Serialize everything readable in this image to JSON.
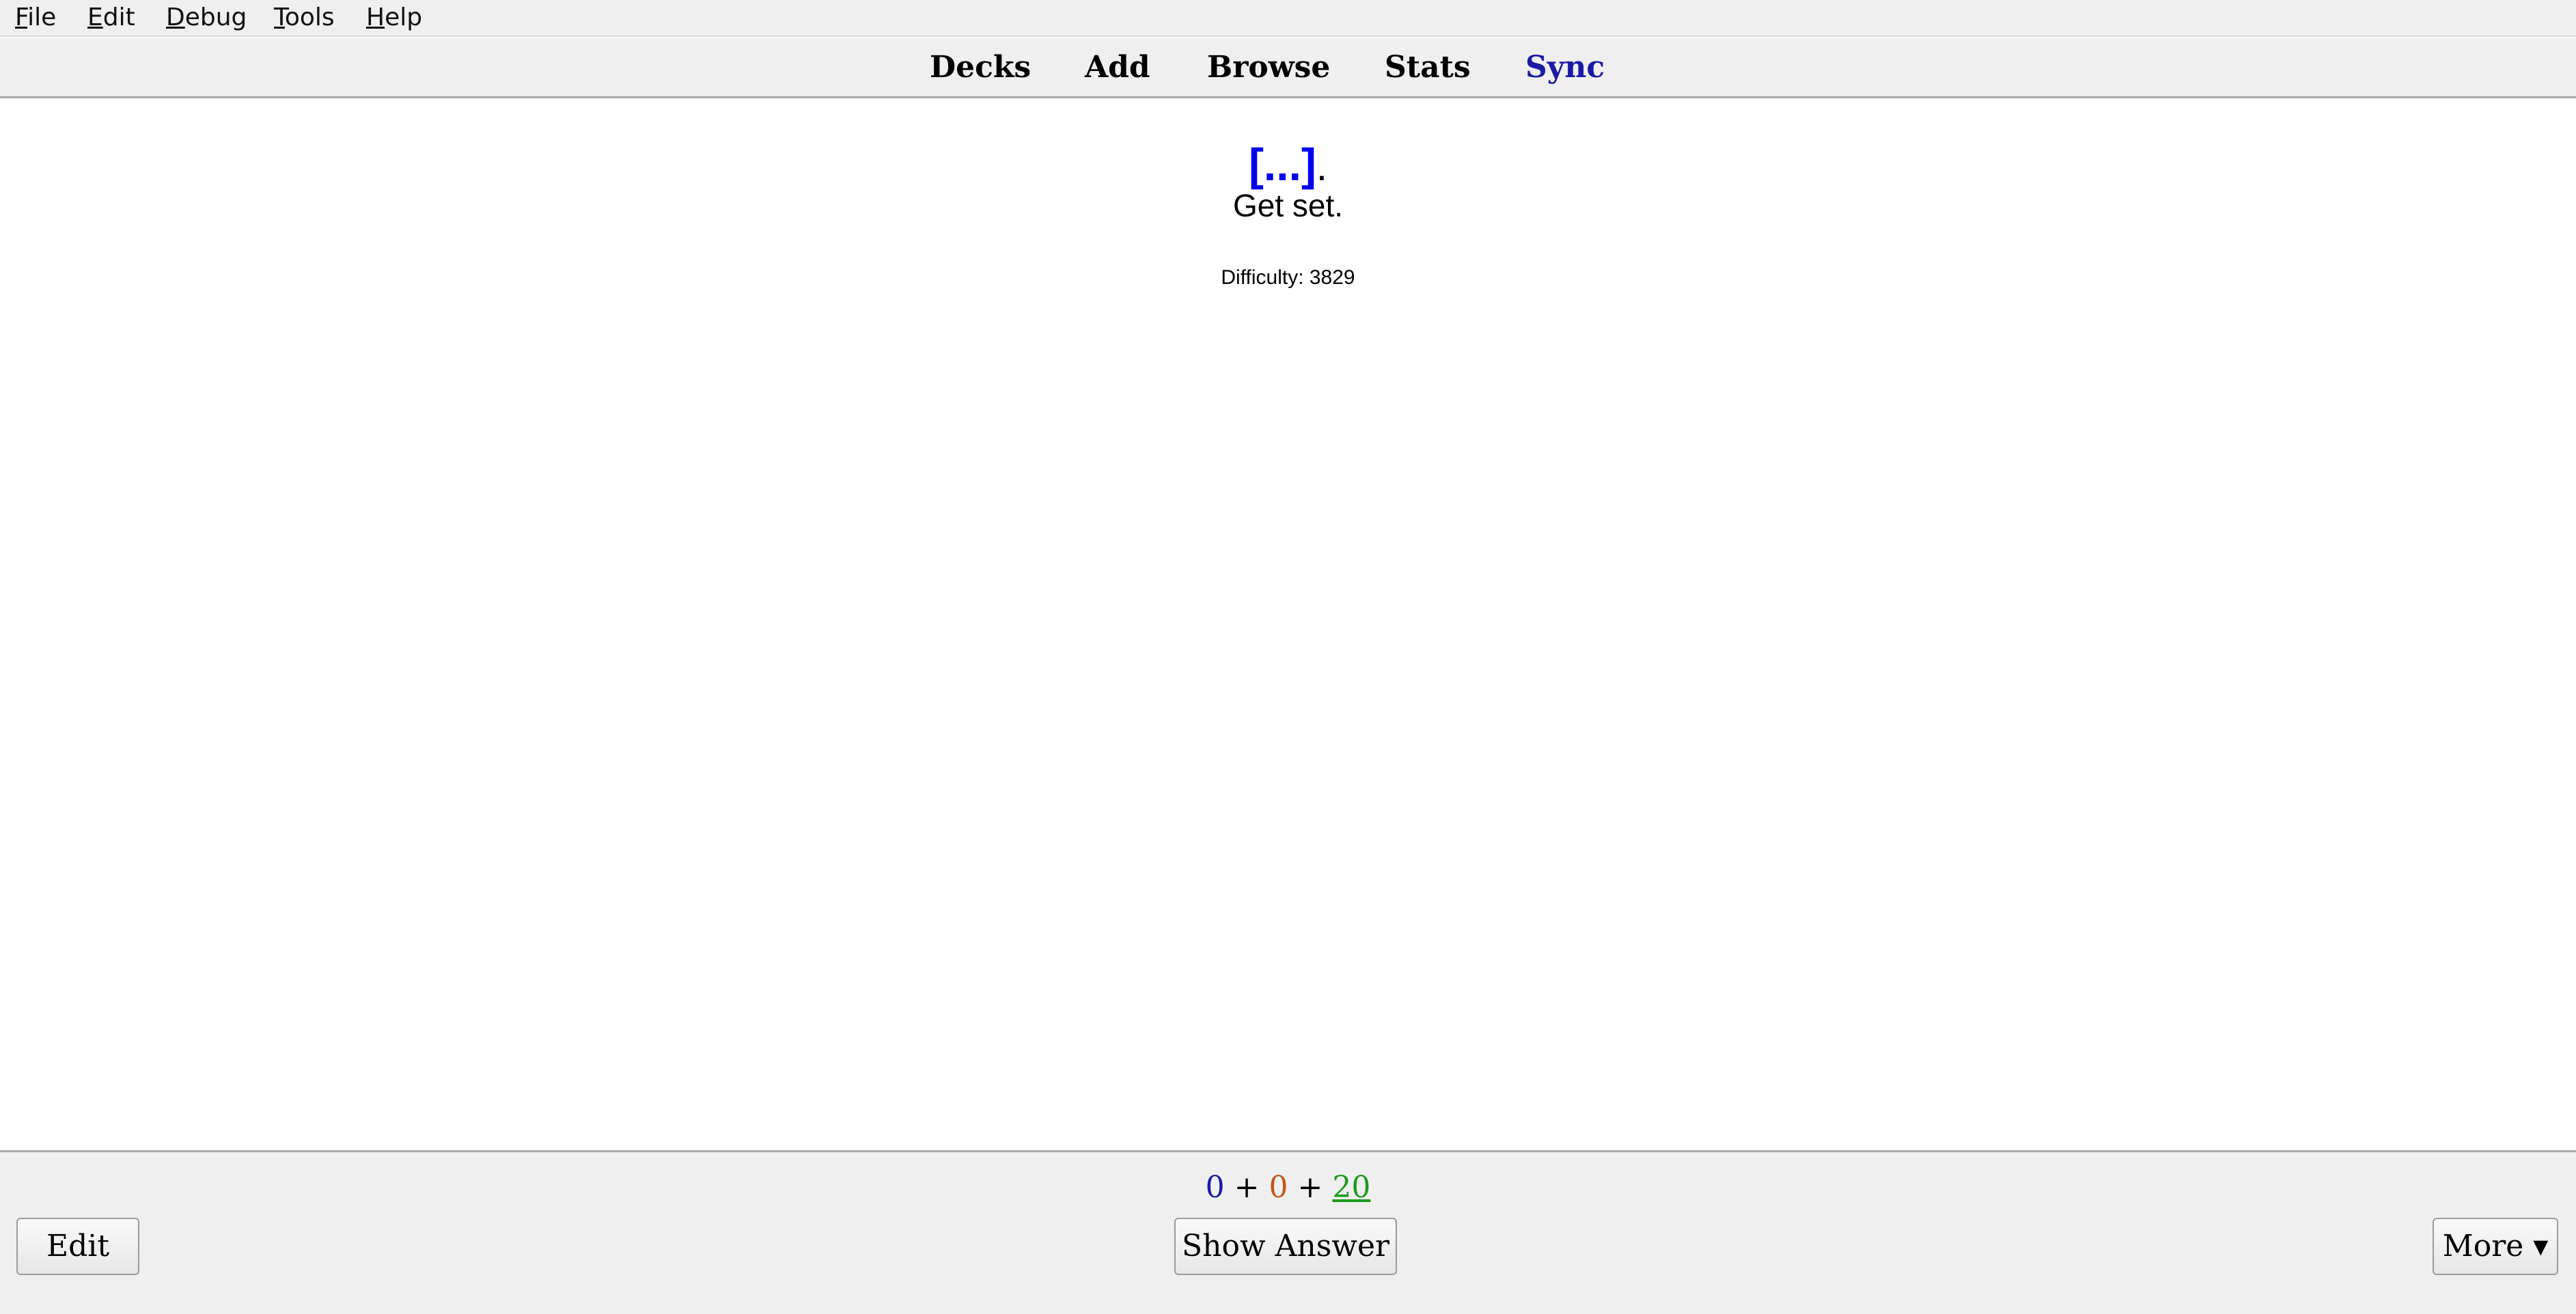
{
  "menubar": {
    "items": [
      {
        "accel": "F",
        "rest": "ile"
      },
      {
        "accel": "E",
        "rest": "dit"
      },
      {
        "accel": "D",
        "rest": "ebug"
      },
      {
        "accel": "T",
        "rest": "ools"
      },
      {
        "accel": "H",
        "rest": "elp"
      }
    ]
  },
  "toolbar": {
    "decks": "Decks",
    "add": "Add",
    "browse": "Browse",
    "stats": "Stats",
    "sync": "Sync",
    "sync_color": "#1a1aa6"
  },
  "card": {
    "cloze": "[...]",
    "cloze_suffix": ".",
    "front_text": "Get set.",
    "difficulty": "Difficulty: 3829",
    "cloze_color": "#0000ee"
  },
  "bottom": {
    "count_new": "0",
    "count_learn": "0",
    "count_review": "20",
    "plus": "+",
    "edit_label": "Edit",
    "show_answer_label": "Show Answer",
    "more_label": "More ▾",
    "colors": {
      "new": "#1a1aa6",
      "learn": "#c35617",
      "review": "#1d9b1d"
    }
  }
}
